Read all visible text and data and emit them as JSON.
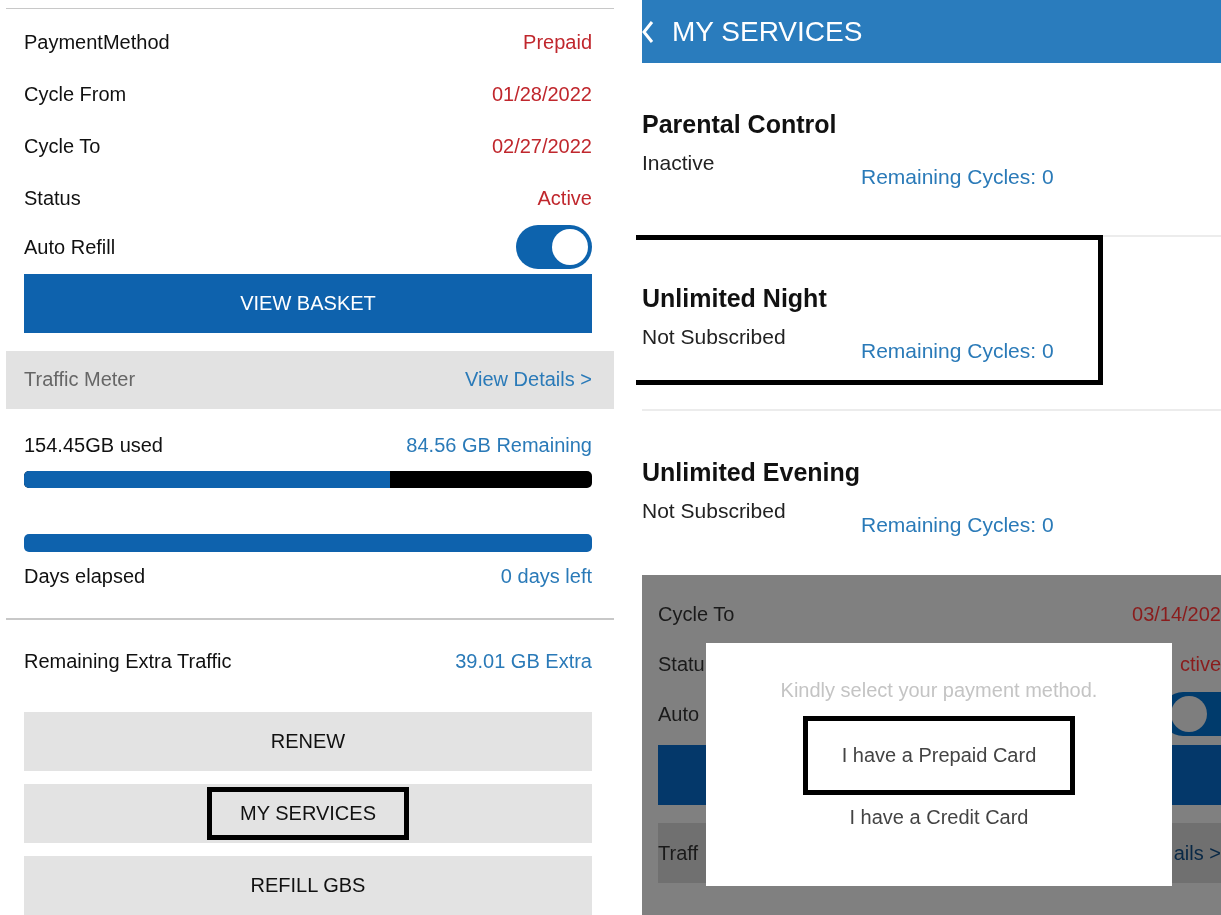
{
  "account_panel": {
    "details": [
      {
        "label": "PaymentMethod",
        "value": "Prepaid"
      },
      {
        "label": "Cycle From",
        "value": "01/28/2022"
      },
      {
        "label": "Cycle To",
        "value": "02/27/2022"
      },
      {
        "label": "Status",
        "value": "Active"
      }
    ],
    "auto_refill": {
      "label": "Auto Refill",
      "on": true
    },
    "view_basket_button": "VIEW BASKET",
    "traffic_meter": {
      "title": "Traffic Meter",
      "link": "View Details >"
    },
    "usage": {
      "used": "154.45GB used",
      "remaining": "84.56 GB Remaining",
      "level": 0.645
    },
    "days": {
      "level": 1,
      "label": "Days elapsed",
      "value": "0 days left"
    },
    "extra": {
      "label": "Remaining Extra Traffic",
      "value": "39.01 GB Extra"
    },
    "actions": [
      {
        "label": "RENEW",
        "highlighted": false
      },
      {
        "label": "MY SERVICES",
        "highlighted": true
      },
      {
        "label": "REFILL GBS",
        "highlighted": false
      }
    ]
  },
  "services_panel": {
    "header": {
      "title": "MY SERVICES"
    },
    "services": [
      {
        "name": "Parental Control",
        "status": "Inactive",
        "remaining": "Remaining Cycles: 0",
        "highlighted": false
      },
      {
        "name": "Unlimited Night",
        "status": "Not Subscribed",
        "remaining": "Remaining Cycles: 0",
        "highlighted": true
      },
      {
        "name": "Unlimited Evening",
        "status": "Not Subscribed",
        "remaining": "Remaining Cycles: 0",
        "highlighted": false
      }
    ],
    "background_rows": [
      {
        "kind": "text",
        "label": "Cycle To",
        "value": "03/14/202"
      },
      {
        "kind": "text",
        "label": "Statu",
        "value": "ctive"
      },
      {
        "kind": "toggle",
        "label": "Auto",
        "on": true
      },
      {
        "kind": "button"
      },
      {
        "kind": "band",
        "label": "Traff",
        "value": "ails >"
      }
    ],
    "dialog": {
      "message": "Kindly select your payment method.",
      "options": [
        {
          "label": "I have a Prepaid Card",
          "highlighted": true
        },
        {
          "label": "I have a Credit Card",
          "highlighted": false
        }
      ]
    }
  }
}
